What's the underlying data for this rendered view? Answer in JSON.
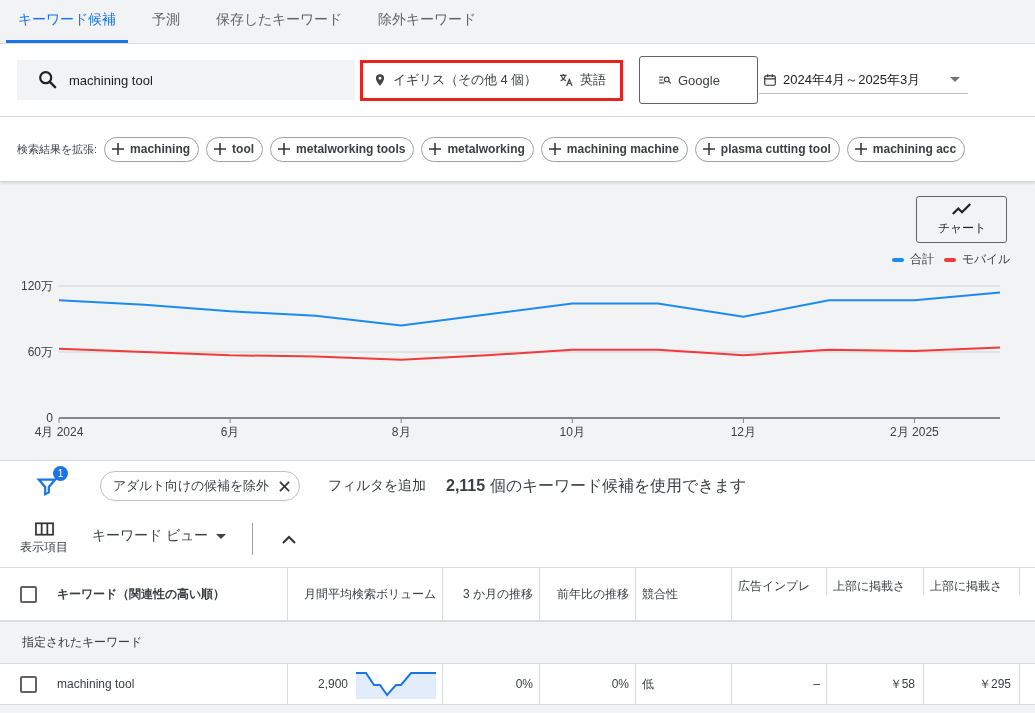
{
  "tabs": [
    {
      "label": "キーワード候補",
      "selected": true
    },
    {
      "label": "予測",
      "selected": false
    },
    {
      "label": "保存したキーワード",
      "selected": false
    },
    {
      "label": "除外キーワード",
      "selected": false
    }
  ],
  "search": {
    "value": "machining tool"
  },
  "location": "イギリス（その他 4 個）",
  "language": "英語",
  "network": "Google",
  "date_range": "2024年4月～2025年3月",
  "expand": {
    "label": "検索結果を拡張:",
    "chips": [
      "machining",
      "tool",
      "metalworking tools",
      "metalworking",
      "machining machine",
      "plasma cutting tool",
      "machining acc"
    ]
  },
  "chart_button": "チャート",
  "chart_data": {
    "type": "line",
    "categories": [
      "4月 2024",
      null,
      "6月",
      null,
      "8月",
      null,
      "10月",
      null,
      "12月",
      null,
      "2月 2025",
      null
    ],
    "series": [
      {
        "name": "合計",
        "color": "#1a8cf0",
        "values": [
          107,
          103,
          97,
          93,
          84,
          94,
          104,
          104,
          92,
          107,
          107,
          114
        ]
      },
      {
        "name": "モバイル",
        "color": "#f23a3a",
        "values": [
          63,
          60,
          57,
          56,
          53,
          57,
          62,
          62,
          57,
          62,
          61,
          64
        ]
      }
    ],
    "ylim": [
      0,
      120
    ],
    "yticks": [
      {
        "value": 0,
        "label": "0"
      },
      {
        "value": 60,
        "label": "60万"
      },
      {
        "value": 120,
        "label": "120万"
      }
    ]
  },
  "filters": {
    "count": "1",
    "chip": "アダルト向けの候補を除外",
    "add": "フィルタを追加",
    "summary": "**2,115** 個のキーワード候補を使用できます"
  },
  "columns_label": "表示項目",
  "view": "キーワード ビュー",
  "table": {
    "all_checked": false,
    "columns": [
      "キーワード（関連性の高い順）",
      "月間平均検索ボリューム",
      "3 か月の推移",
      "前年比の推移",
      "競合性",
      "広告インプレ",
      "上部に掲載さ",
      "上部に掲載さ"
    ],
    "group": "指定されたキーワード",
    "rows": [
      {
        "checked": false,
        "keyword": "machining tool",
        "volume": "2,900",
        "three_month": "0%",
        "yoy": "0%",
        "competition": "低",
        "impressions": "–",
        "bid_low": "￥58",
        "bid_high": "￥295"
      }
    ]
  }
}
